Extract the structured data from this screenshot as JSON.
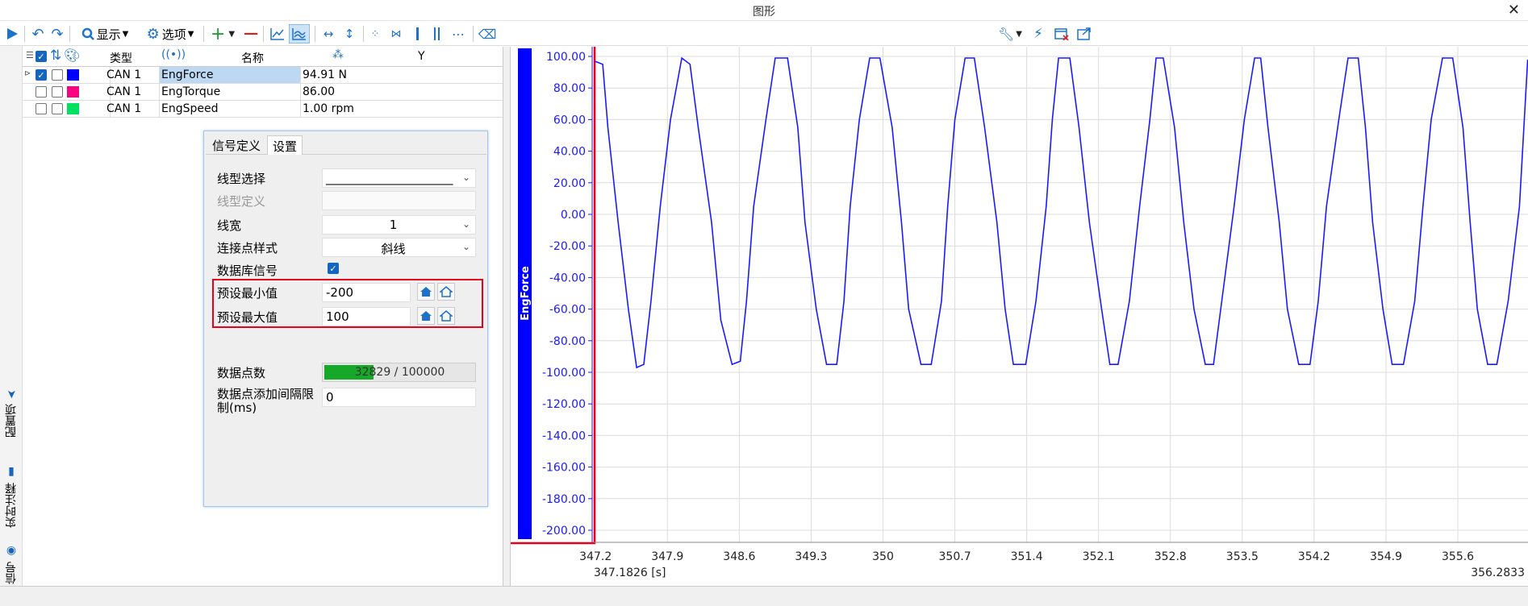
{
  "window": {
    "title": "图形",
    "close": "✕"
  },
  "toolbar": {
    "display_label": "显示",
    "options_label": "选项"
  },
  "grid": {
    "headers": {
      "type": "类型",
      "name": "名称",
      "y": "Y"
    },
    "rows": [
      {
        "checked": true,
        "type": "CAN 1",
        "name": "EngForce",
        "value": "94.91 N",
        "color": "#0000ff",
        "selected": true
      },
      {
        "checked": false,
        "type": "CAN 1",
        "name": "EngTorque",
        "value": "86.00",
        "color": "#ff0080",
        "selected": false
      },
      {
        "checked": false,
        "type": "CAN 1",
        "name": "EngSpeed",
        "value": "1.00 rpm",
        "color": "#00e060",
        "selected": false
      }
    ]
  },
  "side_tabs": {
    "config": "配置项",
    "realtime": "实时注释",
    "signal": "信号"
  },
  "panel": {
    "tabs": [
      "信号定义",
      "设置"
    ],
    "line_type_label": "线型选择",
    "line_type_value": "_____________________",
    "line_def_label": "线型定义",
    "line_width_label": "线宽",
    "line_width_value": "1",
    "join_style_label": "连接点样式",
    "join_style_value": "斜线",
    "db_signal_label": "数据库信号",
    "db_signal_checked": true,
    "preset_min_label": "预设最小值",
    "preset_min_value": "-200",
    "preset_max_label": "预设最大值",
    "preset_max_value": "100",
    "points_label": "数据点数",
    "points_text": "32829 / 100000",
    "points_fraction": 0.328,
    "interval_label_1": "数据点添加间隔限",
    "interval_label_2": "制(ms)",
    "interval_value": "0"
  },
  "chart_data": {
    "type": "line",
    "ylabel": "EngForce",
    "ylim": [
      -200,
      100
    ],
    "y_ticks": [
      "100.00",
      "80.00",
      "60.00",
      "40.00",
      "20.00",
      "0.00",
      "-20.00",
      "-40.00",
      "-60.00",
      "-80.00",
      "-100.00",
      "-120.00",
      "-140.00",
      "-160.00",
      "-180.00",
      "-200.00"
    ],
    "x_ticks": [
      "347.2",
      "347.9",
      "348.6",
      "349.3",
      "350",
      "350.7",
      "351.4",
      "352.1",
      "352.8",
      "353.5",
      "354.2",
      "354.9",
      "355.6"
    ],
    "x_start_label": "347.1826 [s]",
    "x_end_label": "356.2833",
    "xlim": [
      347.1826,
      356.2833
    ],
    "series": [
      {
        "name": "EngForce",
        "color": "#1a1aff",
        "x": [
          347.19,
          347.27,
          347.32,
          347.42,
          347.52,
          347.6,
          347.67,
          347.74,
          347.83,
          347.93,
          348.04,
          348.12,
          348.2,
          348.33,
          348.42,
          348.53,
          348.61,
          348.67,
          348.74,
          348.86,
          348.95,
          349.07,
          349.17,
          349.24,
          349.35,
          349.45,
          349.55,
          349.62,
          349.68,
          349.77,
          349.87,
          349.97,
          350.09,
          350.18,
          350.25,
          350.37,
          350.47,
          350.57,
          350.63,
          350.7,
          350.8,
          350.89,
          350.99,
          351.11,
          351.19,
          351.27,
          351.39,
          351.49,
          351.59,
          351.65,
          351.71,
          351.82,
          351.91,
          352.01,
          352.13,
          352.21,
          352.29,
          352.4,
          352.5,
          352.6,
          352.66,
          352.73,
          352.84,
          352.93,
          353.03,
          353.14,
          353.22,
          353.3,
          353.42,
          353.52,
          353.62,
          353.68,
          353.75,
          353.86,
          353.94,
          354.05,
          354.16,
          354.24,
          354.32,
          354.44,
          354.53,
          354.63,
          354.7,
          354.77,
          354.87,
          354.96,
          355.07,
          355.18,
          355.26,
          355.34,
          355.45,
          355.55,
          355.65,
          355.72,
          355.79,
          355.89,
          355.98,
          356.09,
          356.2,
          356.28
        ],
        "y": [
          97,
          95,
          55,
          -5,
          -60,
          -97,
          -95,
          -55,
          5,
          60,
          99,
          95,
          55,
          -5,
          -67,
          -95,
          -93,
          -55,
          5,
          60,
          99,
          99,
          55,
          -5,
          -60,
          -95,
          -95,
          -55,
          5,
          60,
          99,
          99,
          55,
          -5,
          -60,
          -95,
          -95,
          -55,
          5,
          60,
          99,
          99,
          55,
          -5,
          -60,
          -95,
          -95,
          -55,
          5,
          60,
          99,
          99,
          55,
          -5,
          -60,
          -95,
          -95,
          -55,
          5,
          60,
          99,
          99,
          55,
          -5,
          -60,
          -95,
          -95,
          -55,
          5,
          60,
          99,
          99,
          55,
          -5,
          -60,
          -95,
          -95,
          -55,
          5,
          60,
          99,
          99,
          55,
          -5,
          -60,
          -95,
          -95,
          -55,
          5,
          60,
          99,
          99,
          55,
          -5,
          -60,
          -95,
          -95,
          -55,
          5,
          98
        ]
      }
    ]
  }
}
